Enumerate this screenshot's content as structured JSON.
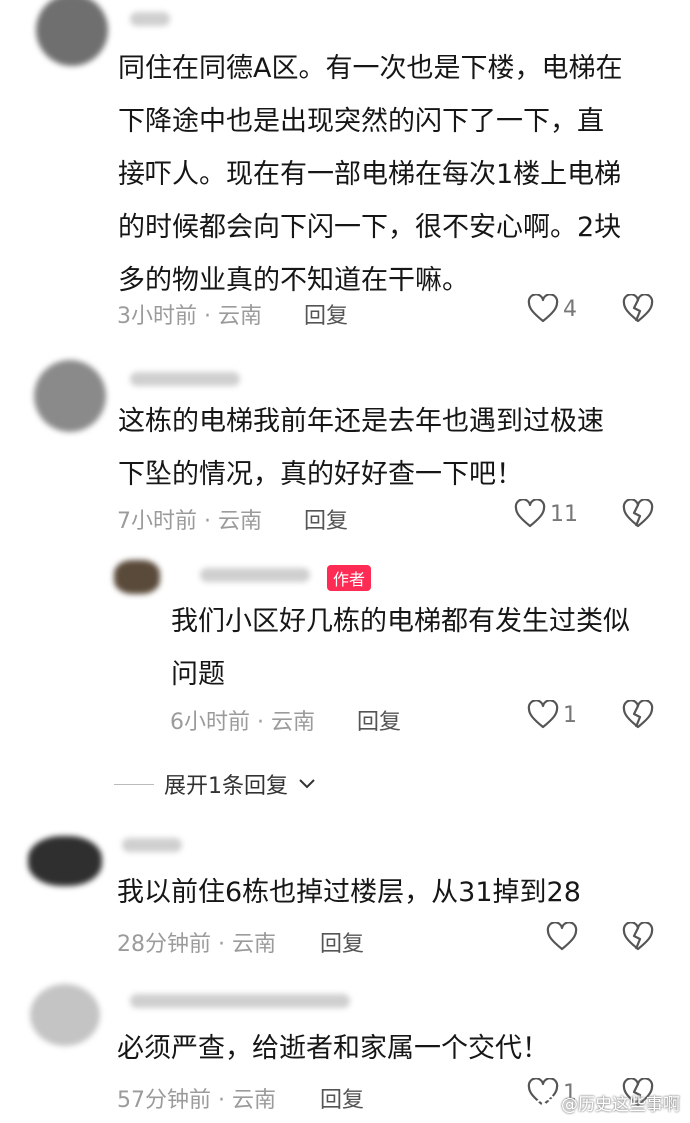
{
  "comments": [
    {
      "text": "同住在同德A区。有一次也是下楼，电梯在\n下降途中也是出现突然的闪下了一下，直\n接吓人。现在有一部电梯在每次1楼上电梯\n的时候都会向下闪一下，很不安心啊。2块\n多的物业真的不知道在干嘛。",
      "time_location": "3小时前 · 云南",
      "reply_label": "回复",
      "like_count": "4"
    },
    {
      "text": "这栋的电梯我前年还是去年也遇到过极速\n下坠的情况，真的好好查一下吧！",
      "time_location": "7小时前 · 云南",
      "reply_label": "回复",
      "like_count": "11",
      "replies": [
        {
          "badge": "作者",
          "text": "我们小区好几栋的电梯都有发生过类似\n问题",
          "time_location": "6小时前 · 云南",
          "reply_label": "回复",
          "like_count": "1"
        }
      ],
      "expand_label": "展开1条回复"
    },
    {
      "text": "我以前住6栋也掉过楼层，从31掉到28",
      "time_location": "28分钟前 · 云南",
      "reply_label": "回复",
      "like_count": ""
    },
    {
      "text": "必须严查，给逝者和家属一个交代！",
      "time_location": "57分钟前 · 云南",
      "reply_label": "回复",
      "like_count": "1"
    }
  ],
  "watermark": "@历史这些事啊",
  "colors": {
    "author_badge": "#fe2c55",
    "meta": "#9b9b9b"
  }
}
